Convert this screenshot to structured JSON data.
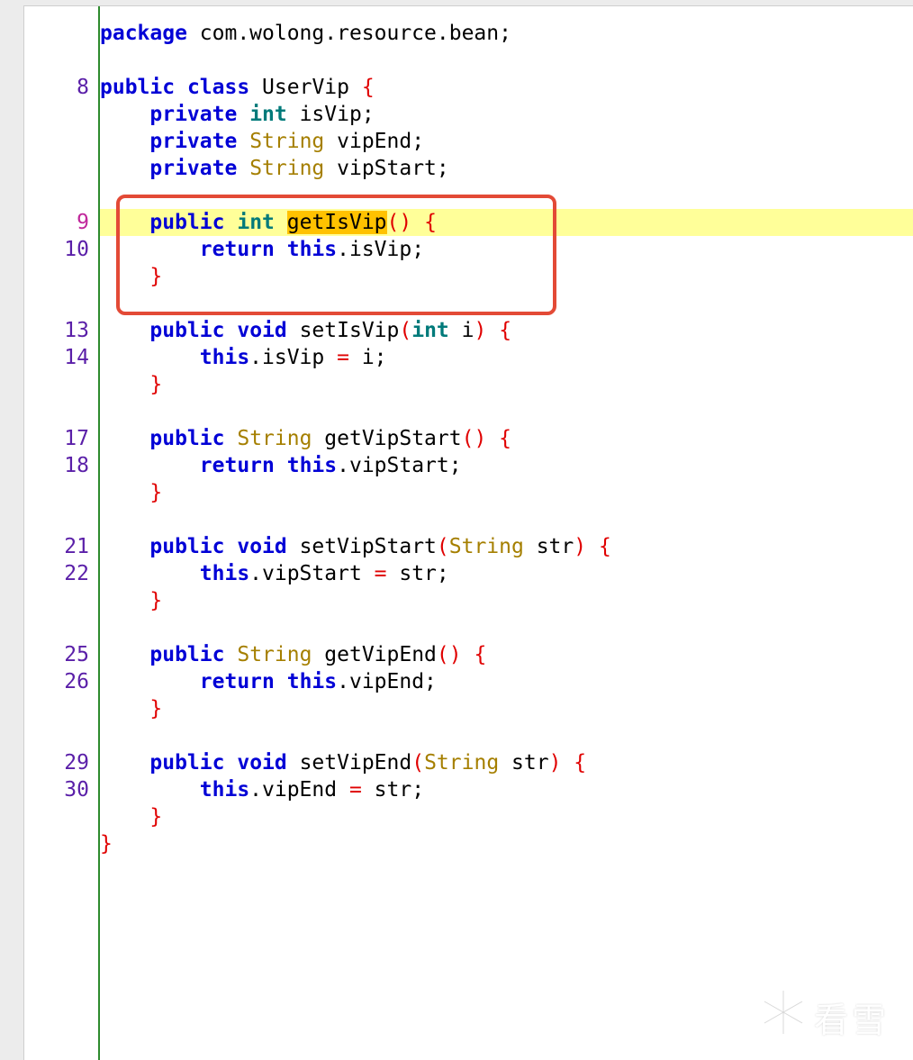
{
  "editor": {
    "lines": [
      {
        "num": "",
        "segs": [
          {
            "t": "package",
            "c": "kw"
          },
          {
            "t": " com.wolong.resource.bean;",
            "c": ""
          }
        ]
      },
      {
        "num": "",
        "segs": []
      },
      {
        "num": "8",
        "segs": [
          {
            "t": "public",
            "c": "kw"
          },
          {
            "t": " ",
            "c": ""
          },
          {
            "t": "class",
            "c": "kw"
          },
          {
            "t": " UserVip ",
            "c": ""
          },
          {
            "t": "{",
            "c": "br"
          }
        ]
      },
      {
        "num": "",
        "segs": [
          {
            "t": "    ",
            "c": ""
          },
          {
            "t": "private",
            "c": "kw"
          },
          {
            "t": " ",
            "c": ""
          },
          {
            "t": "int",
            "c": "kt"
          },
          {
            "t": " isVip;",
            "c": ""
          }
        ]
      },
      {
        "num": "",
        "segs": [
          {
            "t": "    ",
            "c": ""
          },
          {
            "t": "private",
            "c": "kw"
          },
          {
            "t": " ",
            "c": ""
          },
          {
            "t": "String",
            "c": "ty"
          },
          {
            "t": " vipEnd;",
            "c": ""
          }
        ]
      },
      {
        "num": "",
        "segs": [
          {
            "t": "    ",
            "c": ""
          },
          {
            "t": "private",
            "c": "kw"
          },
          {
            "t": " ",
            "c": ""
          },
          {
            "t": "String",
            "c": "ty"
          },
          {
            "t": " vipStart;",
            "c": ""
          }
        ]
      },
      {
        "num": "",
        "segs": []
      },
      {
        "num": "9",
        "hl": true,
        "segs": [
          {
            "t": "    ",
            "c": ""
          },
          {
            "t": "public",
            "c": "kw"
          },
          {
            "t": " ",
            "c": ""
          },
          {
            "t": "int",
            "c": "kt"
          },
          {
            "t": " ",
            "c": ""
          },
          {
            "t": "getIsVip",
            "c": "sel"
          },
          {
            "t": "()",
            "c": "br"
          },
          {
            "t": " ",
            "c": ""
          },
          {
            "t": "{",
            "c": "br"
          }
        ]
      },
      {
        "num": "10",
        "segs": [
          {
            "t": "        ",
            "c": ""
          },
          {
            "t": "return",
            "c": "kw"
          },
          {
            "t": " ",
            "c": ""
          },
          {
            "t": "this",
            "c": "kw"
          },
          {
            "t": ".isVip;",
            "c": ""
          }
        ]
      },
      {
        "num": "",
        "segs": [
          {
            "t": "    ",
            "c": ""
          },
          {
            "t": "}",
            "c": "br"
          }
        ]
      },
      {
        "num": "",
        "segs": []
      },
      {
        "num": "13",
        "segs": [
          {
            "t": "    ",
            "c": ""
          },
          {
            "t": "public",
            "c": "kw"
          },
          {
            "t": " ",
            "c": ""
          },
          {
            "t": "void",
            "c": "kw"
          },
          {
            "t": " setIsVip",
            "c": ""
          },
          {
            "t": "(",
            "c": "br"
          },
          {
            "t": "int",
            "c": "kt"
          },
          {
            "t": " i",
            "c": ""
          },
          {
            "t": ")",
            "c": "br"
          },
          {
            "t": " ",
            "c": ""
          },
          {
            "t": "{",
            "c": "br"
          }
        ]
      },
      {
        "num": "14",
        "segs": [
          {
            "t": "        ",
            "c": ""
          },
          {
            "t": "this",
            "c": "kw"
          },
          {
            "t": ".isVip ",
            "c": ""
          },
          {
            "t": "=",
            "c": "op"
          },
          {
            "t": " i;",
            "c": ""
          }
        ]
      },
      {
        "num": "",
        "segs": [
          {
            "t": "    ",
            "c": ""
          },
          {
            "t": "}",
            "c": "br"
          }
        ]
      },
      {
        "num": "",
        "segs": []
      },
      {
        "num": "17",
        "segs": [
          {
            "t": "    ",
            "c": ""
          },
          {
            "t": "public",
            "c": "kw"
          },
          {
            "t": " ",
            "c": ""
          },
          {
            "t": "String",
            "c": "ty"
          },
          {
            "t": " getVipStart",
            "c": ""
          },
          {
            "t": "()",
            "c": "br"
          },
          {
            "t": " ",
            "c": ""
          },
          {
            "t": "{",
            "c": "br"
          }
        ]
      },
      {
        "num": "18",
        "segs": [
          {
            "t": "        ",
            "c": ""
          },
          {
            "t": "return",
            "c": "kw"
          },
          {
            "t": " ",
            "c": ""
          },
          {
            "t": "this",
            "c": "kw"
          },
          {
            "t": ".vipStart;",
            "c": ""
          }
        ]
      },
      {
        "num": "",
        "segs": [
          {
            "t": "    ",
            "c": ""
          },
          {
            "t": "}",
            "c": "br"
          }
        ]
      },
      {
        "num": "",
        "segs": []
      },
      {
        "num": "21",
        "segs": [
          {
            "t": "    ",
            "c": ""
          },
          {
            "t": "public",
            "c": "kw"
          },
          {
            "t": " ",
            "c": ""
          },
          {
            "t": "void",
            "c": "kw"
          },
          {
            "t": " setVipStart",
            "c": ""
          },
          {
            "t": "(",
            "c": "br"
          },
          {
            "t": "String",
            "c": "ty"
          },
          {
            "t": " str",
            "c": ""
          },
          {
            "t": ")",
            "c": "br"
          },
          {
            "t": " ",
            "c": ""
          },
          {
            "t": "{",
            "c": "br"
          }
        ]
      },
      {
        "num": "22",
        "segs": [
          {
            "t": "        ",
            "c": ""
          },
          {
            "t": "this",
            "c": "kw"
          },
          {
            "t": ".vipStart ",
            "c": ""
          },
          {
            "t": "=",
            "c": "op"
          },
          {
            "t": " str;",
            "c": ""
          }
        ]
      },
      {
        "num": "",
        "segs": [
          {
            "t": "    ",
            "c": ""
          },
          {
            "t": "}",
            "c": "br"
          }
        ]
      },
      {
        "num": "",
        "segs": []
      },
      {
        "num": "25",
        "segs": [
          {
            "t": "    ",
            "c": ""
          },
          {
            "t": "public",
            "c": "kw"
          },
          {
            "t": " ",
            "c": ""
          },
          {
            "t": "String",
            "c": "ty"
          },
          {
            "t": " getVipEnd",
            "c": ""
          },
          {
            "t": "()",
            "c": "br"
          },
          {
            "t": " ",
            "c": ""
          },
          {
            "t": "{",
            "c": "br"
          }
        ]
      },
      {
        "num": "26",
        "segs": [
          {
            "t": "        ",
            "c": ""
          },
          {
            "t": "return",
            "c": "kw"
          },
          {
            "t": " ",
            "c": ""
          },
          {
            "t": "this",
            "c": "kw"
          },
          {
            "t": ".vipEnd;",
            "c": ""
          }
        ]
      },
      {
        "num": "",
        "segs": [
          {
            "t": "    ",
            "c": ""
          },
          {
            "t": "}",
            "c": "br"
          }
        ]
      },
      {
        "num": "",
        "segs": []
      },
      {
        "num": "29",
        "segs": [
          {
            "t": "    ",
            "c": ""
          },
          {
            "t": "public",
            "c": "kw"
          },
          {
            "t": " ",
            "c": ""
          },
          {
            "t": "void",
            "c": "kw"
          },
          {
            "t": " setVipEnd",
            "c": ""
          },
          {
            "t": "(",
            "c": "br"
          },
          {
            "t": "String",
            "c": "ty"
          },
          {
            "t": " str",
            "c": ""
          },
          {
            "t": ")",
            "c": "br"
          },
          {
            "t": " ",
            "c": ""
          },
          {
            "t": "{",
            "c": "br"
          }
        ]
      },
      {
        "num": "30",
        "segs": [
          {
            "t": "        ",
            "c": ""
          },
          {
            "t": "this",
            "c": "kw"
          },
          {
            "t": ".vipEnd ",
            "c": ""
          },
          {
            "t": "=",
            "c": "op"
          },
          {
            "t": " str;",
            "c": ""
          }
        ]
      },
      {
        "num": "",
        "segs": [
          {
            "t": "    ",
            "c": ""
          },
          {
            "t": "}",
            "c": "br"
          }
        ]
      },
      {
        "num": "",
        "segs": [
          {
            "t": "}",
            "c": "br"
          }
        ]
      }
    ],
    "highlighted_line": "9",
    "selected_token": "getIsVip"
  },
  "annotation": {
    "box_color": "#e34a36",
    "enclosed_lines": [
      "9",
      "10"
    ]
  },
  "watermark": {
    "text": "看雪",
    "icon": "snowflake-icon"
  },
  "colors": {
    "keyword": "#0000d6",
    "primitive_type": "#007a7a",
    "class_type": "#a57f00",
    "bracket": "#e00000",
    "line_number": "#5a1fa8",
    "current_line_bg": "#ffff99",
    "selection_bg": "#ffc200",
    "gutter_rule": "#2e8b2e"
  }
}
